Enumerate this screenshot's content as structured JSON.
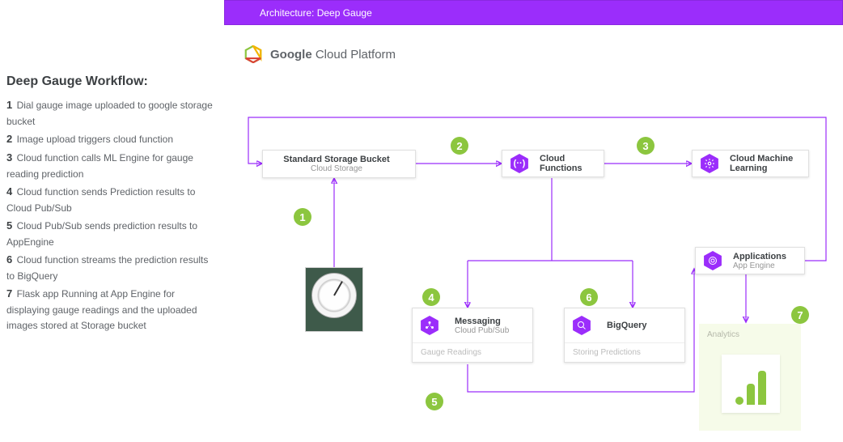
{
  "sidebar": {
    "title": "Deep Gauge Workflow:",
    "steps": [
      {
        "num": "1",
        "text": "Dial gauge image uploaded to google storage bucket"
      },
      {
        "num": "2",
        "text": "Image upload triggers cloud function"
      },
      {
        "num": "3",
        "text": "Cloud function calls ML Engine for gauge reading prediction"
      },
      {
        "num": "4",
        "text": "Cloud function sends Prediction results to Cloud Pub/Sub"
      },
      {
        "num": "5",
        "text": "Cloud Pub/Sub sends prediction results  to AppEngine"
      },
      {
        "num": "6",
        "text": "Cloud function streams the prediction results to BigQuery"
      },
      {
        "num": "7",
        "text": "Flask app Running at App Engine for displaying gauge readings and the uploaded images stored at Storage bucket"
      }
    ]
  },
  "header": {
    "title": "Architecture: Deep Gauge"
  },
  "platform": {
    "brand": "Google",
    "rest": " Cloud Platform"
  },
  "nodes": {
    "storage": {
      "title": "Standard Storage Bucket",
      "sub": "Cloud Storage"
    },
    "functions": {
      "title": "Cloud Functions"
    },
    "ml": {
      "title": "Cloud Machine Learning"
    },
    "messaging": {
      "title": "Messaging",
      "sub": "Cloud Pub/Sub",
      "footer": "Gauge Readings"
    },
    "bigquery": {
      "title": "BigQuery",
      "footer": "Storing Predictions"
    },
    "apps": {
      "title": "Applications",
      "sub": "App Engine"
    }
  },
  "analytics": {
    "label": "Analytics"
  },
  "badges": [
    "1",
    "2",
    "3",
    "4",
    "5",
    "6",
    "7"
  ]
}
